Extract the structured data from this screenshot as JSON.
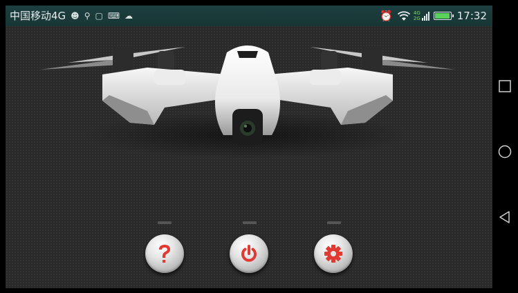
{
  "status_bar": {
    "carrier": "中国移动4G",
    "icons": [
      "notification-icon",
      "chat-icon",
      "sim-icon",
      "keyboard-icon",
      "weather-icon"
    ],
    "alarm_icon": "alarm-icon",
    "wifi_icon": "wifi-icon",
    "network_top": "4G",
    "network_bottom": "2G",
    "battery_level": 0.9,
    "time": "17:32"
  },
  "hero": {
    "image": "drone-illustration"
  },
  "actions": [
    {
      "name": "help",
      "icon": "question-icon",
      "color": "#e03a33"
    },
    {
      "name": "power",
      "icon": "power-icon",
      "color": "#e03a33"
    },
    {
      "name": "settings",
      "icon": "gear-icon",
      "color": "#e03a33"
    }
  ],
  "navigation": {
    "recents": "square-icon",
    "home": "circle-icon",
    "back": "triangle-back-icon"
  }
}
